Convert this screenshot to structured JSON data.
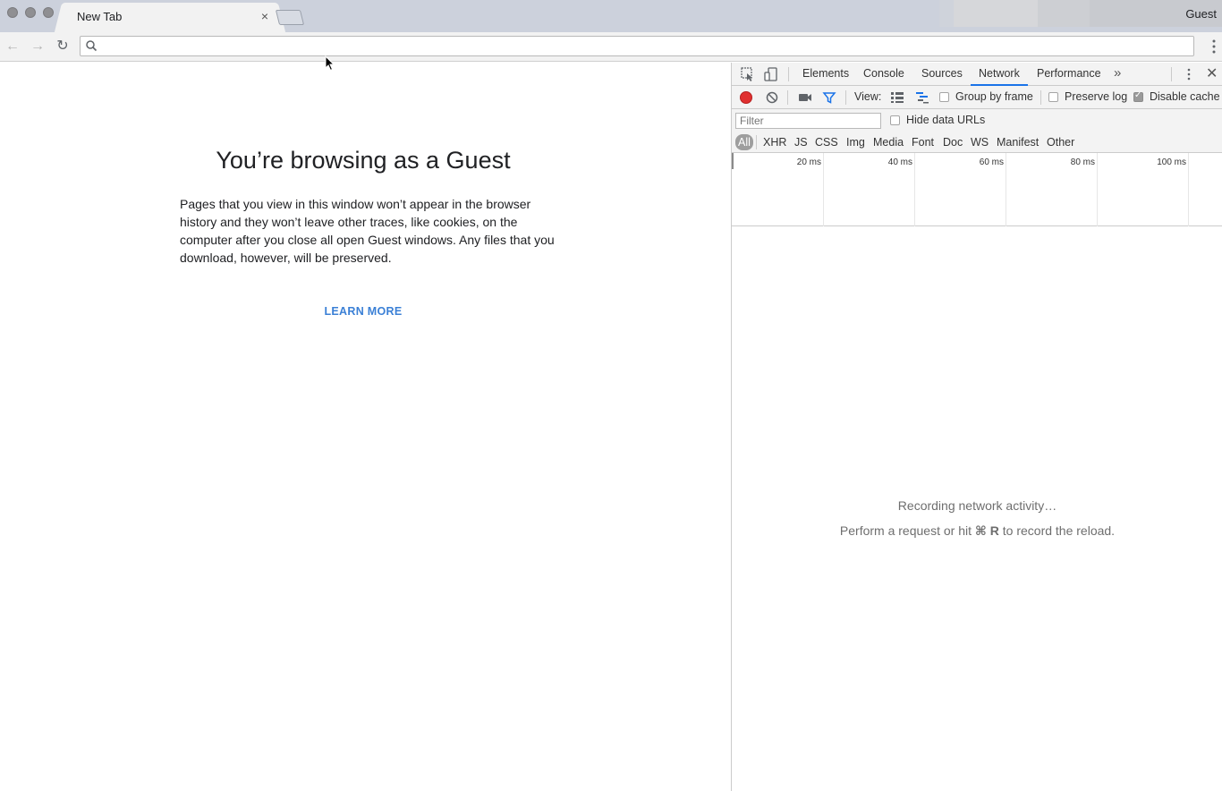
{
  "tabstrip": {
    "tab_title": "New Tab",
    "close_glyph": "×",
    "profile_name": "Guest"
  },
  "toolbar": {
    "back_glyph": "←",
    "forward_glyph": "→",
    "reload_glyph": "↻",
    "omnibox_value": ""
  },
  "page": {
    "title": "You’re browsing as a Guest",
    "body": "Pages that you view in this window won’t appear in the browser history and they won’t leave other traces, like cookies, on the computer after you close all open Guest windows. Any files that you download, however, will be preserved.",
    "learn_more": "LEARN MORE",
    "link_color": "#3b80d6"
  },
  "devtools": {
    "tabs": [
      "Elements",
      "Console",
      "Sources",
      "Network",
      "Performance"
    ],
    "active_tab": "Network",
    "more_glyph": "»",
    "close_glyph": "✕",
    "network_toolbar": {
      "view_label": "View:",
      "group_by_frame": {
        "label": "Group by frame",
        "checked": false
      },
      "preserve_log": {
        "label": "Preserve log",
        "checked": false
      },
      "disable_cache": {
        "label": "Disable cache",
        "checked": true
      },
      "record_color": "#e03030"
    },
    "filter": {
      "placeholder": "Filter",
      "hide_data_urls": {
        "label": "Hide data URLs",
        "checked": false
      }
    },
    "types": [
      "All",
      "XHR",
      "JS",
      "CSS",
      "Img",
      "Media",
      "Font",
      "Doc",
      "WS",
      "Manifest",
      "Other"
    ],
    "active_type": "All",
    "timeline_ticks": [
      "20 ms",
      "40 ms",
      "60 ms",
      "80 ms",
      "100 ms"
    ],
    "empty_line1": "Recording network activity…",
    "empty_line2_prefix": "Perform a request or hit ",
    "empty_line2_key": "⌘ R",
    "empty_line2_suffix": " to record the reload."
  }
}
